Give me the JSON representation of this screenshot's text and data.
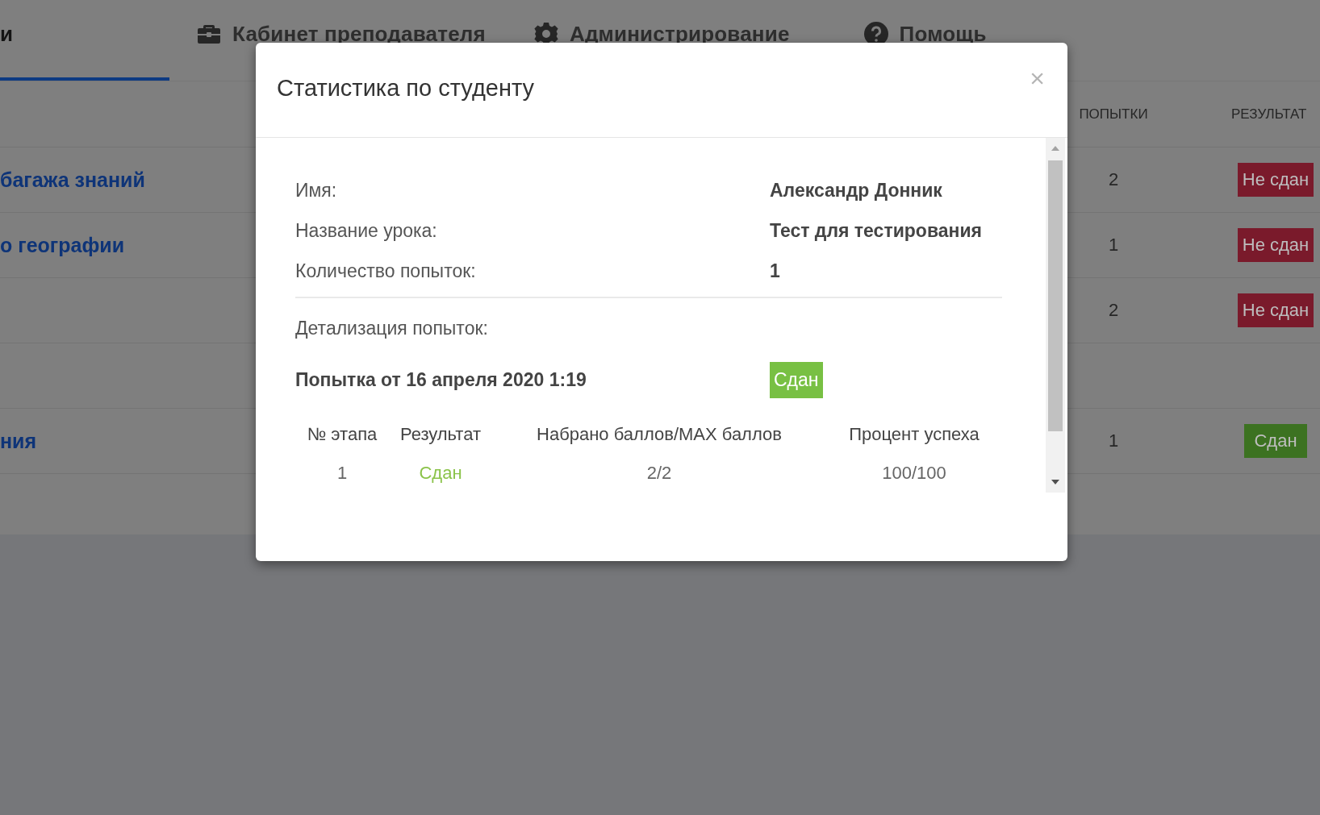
{
  "nav": {
    "tabs": [
      {
        "label": "и",
        "selected": true,
        "kind": "plain"
      },
      {
        "label": "Кабинет преподавателя",
        "selected": false,
        "kind": "briefcase"
      },
      {
        "label": "Администрирование",
        "selected": false,
        "kind": "gear"
      },
      {
        "label": "Помощь",
        "selected": false,
        "kind": "help"
      }
    ]
  },
  "table": {
    "columns": [
      "ПОПЫТКИ",
      "РЕЗУЛЬТАТ"
    ],
    "rows": [
      {
        "title": "багажа знаний",
        "attempts": "2",
        "result": {
          "label": "Не сдан",
          "passed": false
        }
      },
      {
        "title": "о географии",
        "attempts": "1",
        "result": {
          "label": "Не сдан",
          "passed": false
        }
      },
      {
        "attempts": "2",
        "result": {
          "label": "Не сдан",
          "passed": false
        }
      },
      {},
      {
        "title": "ния",
        "attempts": "1",
        "result": {
          "label": "Сдан",
          "passed": true
        }
      }
    ]
  },
  "modal": {
    "title": "Статистика по студенту",
    "close": "×",
    "fields": [
      {
        "label": "Имя:",
        "value": "Александр Донник"
      },
      {
        "label": "Название урока:",
        "value": "Тест для тестирования"
      },
      {
        "label": "Количество попыток:",
        "value": "1"
      }
    ],
    "details_label": "Детализация попыток:",
    "attempt": {
      "title": "Попытка от 16 апреля 2020 1:19",
      "status": {
        "label": "Сдан",
        "passed": true
      }
    },
    "stages": {
      "columns": [
        "№ этапа",
        "Результат",
        "Набрано баллов/MAX баллов",
        "Процент успеха"
      ],
      "rows": [
        {
          "stage": "1",
          "result": "Сдан",
          "passed": true,
          "score": "2/2",
          "percent": "100/100"
        }
      ]
    }
  }
}
